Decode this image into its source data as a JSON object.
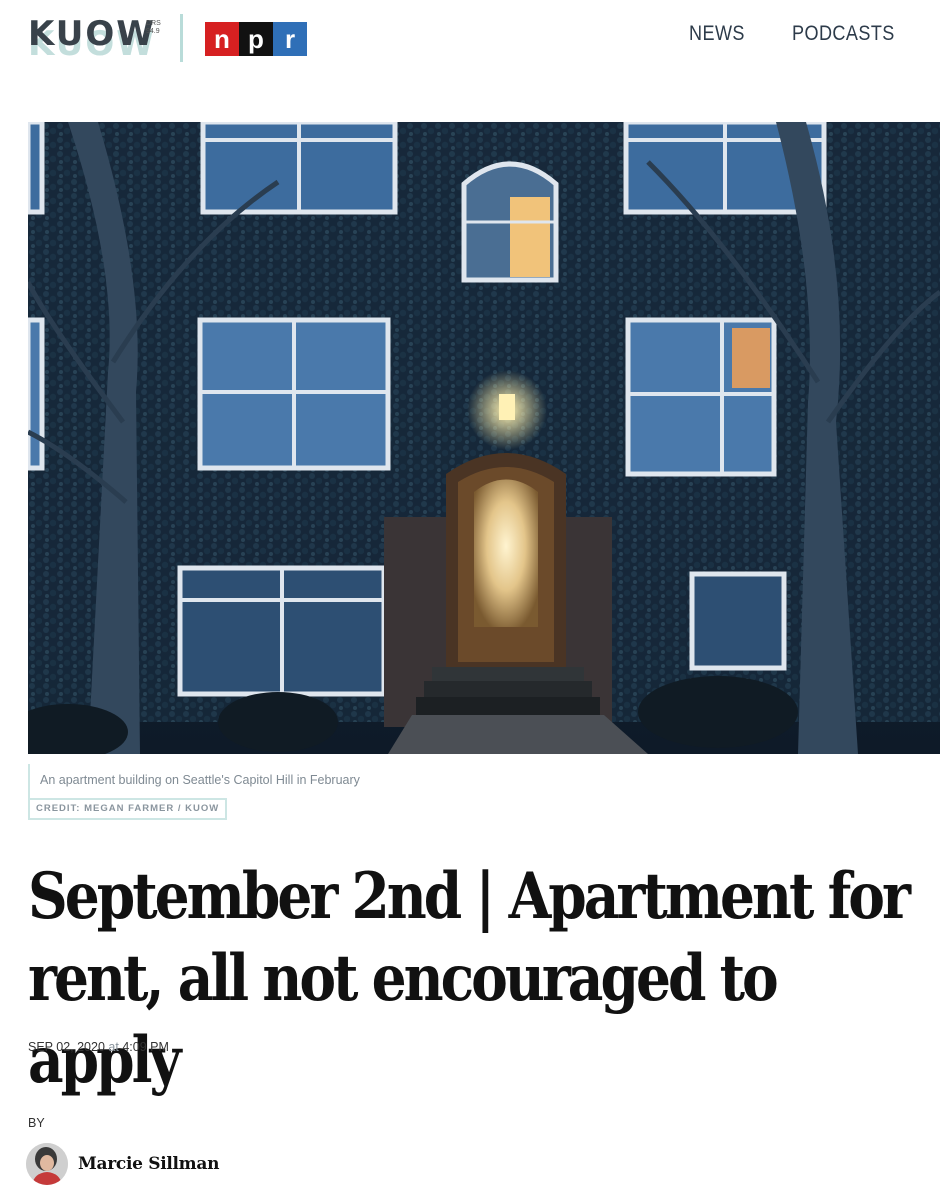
{
  "header": {
    "logo_text": "KUOW",
    "logo_freq_line1": "DRS",
    "logo_freq_line2": "94.9",
    "npr_letters": [
      "n",
      "p",
      "r"
    ],
    "nav": [
      "NEWS",
      "PODCASTS"
    ]
  },
  "hero": {
    "caption": "An apartment building on Seattle's Capitol Hill in February",
    "credit": "CREDIT: MEGAN FARMER / KUOW"
  },
  "article": {
    "headline": "September 2nd | Apartment for rent, all not encouraged to apply",
    "date": "SEP 02, 2020",
    "at": "at",
    "time": "4:09 PM",
    "by_label": "BY",
    "author": "Marcie Sillman"
  },
  "colors": {
    "npr_red": "#d62021",
    "npr_black": "#111111",
    "npr_blue": "#2f6fb7",
    "accent_teal": "#cde6e4"
  }
}
